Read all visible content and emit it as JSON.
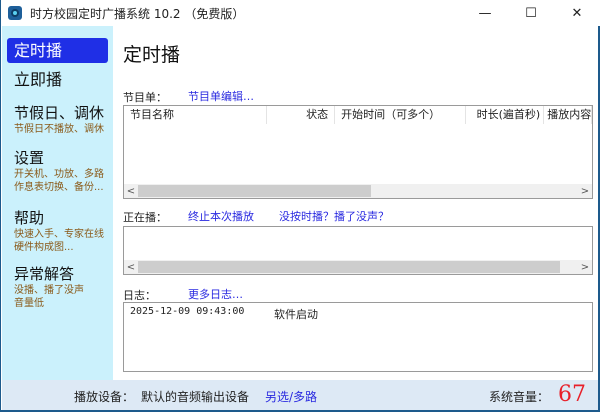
{
  "window": {
    "title": "时方校园定时广播系统 10.2 （免费版）",
    "minimize": "—",
    "maximize": "☐",
    "close": "✕"
  },
  "sidebar": {
    "items": [
      {
        "label": "定时播"
      },
      {
        "label": "立即播"
      },
      {
        "label": "节假日、调休",
        "sub": [
          "节假日不播放、调休"
        ]
      },
      {
        "label": "设置",
        "sub": [
          "开关机、功放、多路",
          "作息表切换、备份..."
        ]
      },
      {
        "label": "帮助",
        "sub": [
          "快速入手、专家在线",
          "硬件构成图..."
        ]
      },
      {
        "label": "异常解答",
        "sub": [
          "没播、播了没声",
          "音量低"
        ]
      }
    ]
  },
  "main": {
    "title": "定时播",
    "program": {
      "label": "节目单：",
      "edit_link": "节目单编辑…",
      "columns": [
        "节目名称",
        "状态",
        "开始时间（可多个）",
        "时长(遍首秒)",
        "播放内容"
      ]
    },
    "playing": {
      "label": "正在播：",
      "stop_link": "终止本次播放",
      "help_link": "没按时播？播了没声？"
    },
    "log": {
      "label": "日志：",
      "more_link": "更多日志…",
      "entries": [
        {
          "time": "2025-12-09 09:43:00",
          "message": "软件启动"
        }
      ]
    }
  },
  "status": {
    "device_label": "播放设备：",
    "device": "默认的音频输出设备",
    "device_link": "另选/多路",
    "volume_label": "系统音量：",
    "volume": "67",
    "volume_color": "#e8202a"
  }
}
